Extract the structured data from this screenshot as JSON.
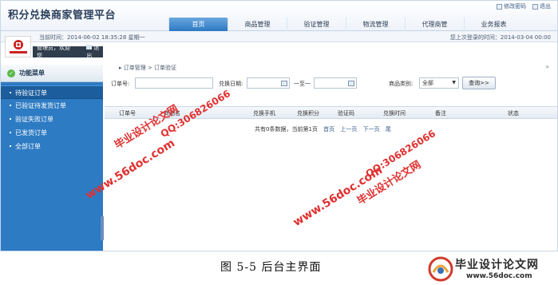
{
  "header": {
    "app_title": "积分兑换商家管理平台",
    "top_links": [
      {
        "label": "修改密码",
        "icon": "edit-icon"
      },
      {
        "label": "退出",
        "icon": "exit-icon"
      }
    ]
  },
  "nav": {
    "tabs": [
      {
        "label": "首页",
        "active": true
      },
      {
        "label": "商品管理",
        "active": false
      },
      {
        "label": "验证管理",
        "active": false
      },
      {
        "label": "物流管理",
        "active": false
      },
      {
        "label": "代理商管",
        "active": false
      },
      {
        "label": "业务报表",
        "active": false
      }
    ]
  },
  "status": {
    "now": "当前时间：2014-06-02 18:35:28 星期一",
    "last_login": "您上次登录的时间：2014-03-04 00:00"
  },
  "user": {
    "greeting": "管理员，欢迎您",
    "logout": "退出"
  },
  "sidebar": {
    "title": "功能菜单",
    "items": [
      {
        "label": "待验证订单",
        "selected": true
      },
      {
        "label": "已验证待发货订单",
        "selected": false
      },
      {
        "label": "验证失败订单",
        "selected": false
      },
      {
        "label": "已发货订单",
        "selected": false
      },
      {
        "label": "全部订单",
        "selected": false
      }
    ]
  },
  "content": {
    "breadcrumb": "▸ 订单管理 > 订单验证",
    "collapse": "»",
    "filters": {
      "order_no_label": "订单号:",
      "date_label": "兑换日期:",
      "to_label": "一至一",
      "category_label": "商品类别:",
      "category_value": "全部",
      "query_button": "查询>>"
    },
    "table": {
      "headers": [
        "订单号",
        "商品名",
        "兑换手机",
        "兑换积分",
        "验证码",
        "兑换时间",
        "备注",
        "状态"
      ]
    },
    "pager": {
      "summary": "共有0条数据，当前第1页",
      "links": [
        "首页",
        "上一页",
        "下一页",
        "尾"
      ]
    }
  },
  "watermarks": [
    {
      "text": "毕业设计论文网",
      "color": "red"
    },
    {
      "text": "QQ:306826066",
      "color": "red"
    },
    {
      "text": "www.56doc.com",
      "color": "red"
    },
    {
      "text": "www.56doc.com",
      "color": "red"
    },
    {
      "text": "QQ:306826066",
      "color": "red"
    },
    {
      "text": "毕业设计论文网",
      "color": "red"
    }
  ],
  "caption": "图 5-5  后台主界面",
  "brand": {
    "name": "毕业设计论文网",
    "url": "www.56doc.com"
  },
  "colors": {
    "accent": "#2d7bc3",
    "active_tab": "#2d78c2",
    "watermark": "#e03030"
  }
}
